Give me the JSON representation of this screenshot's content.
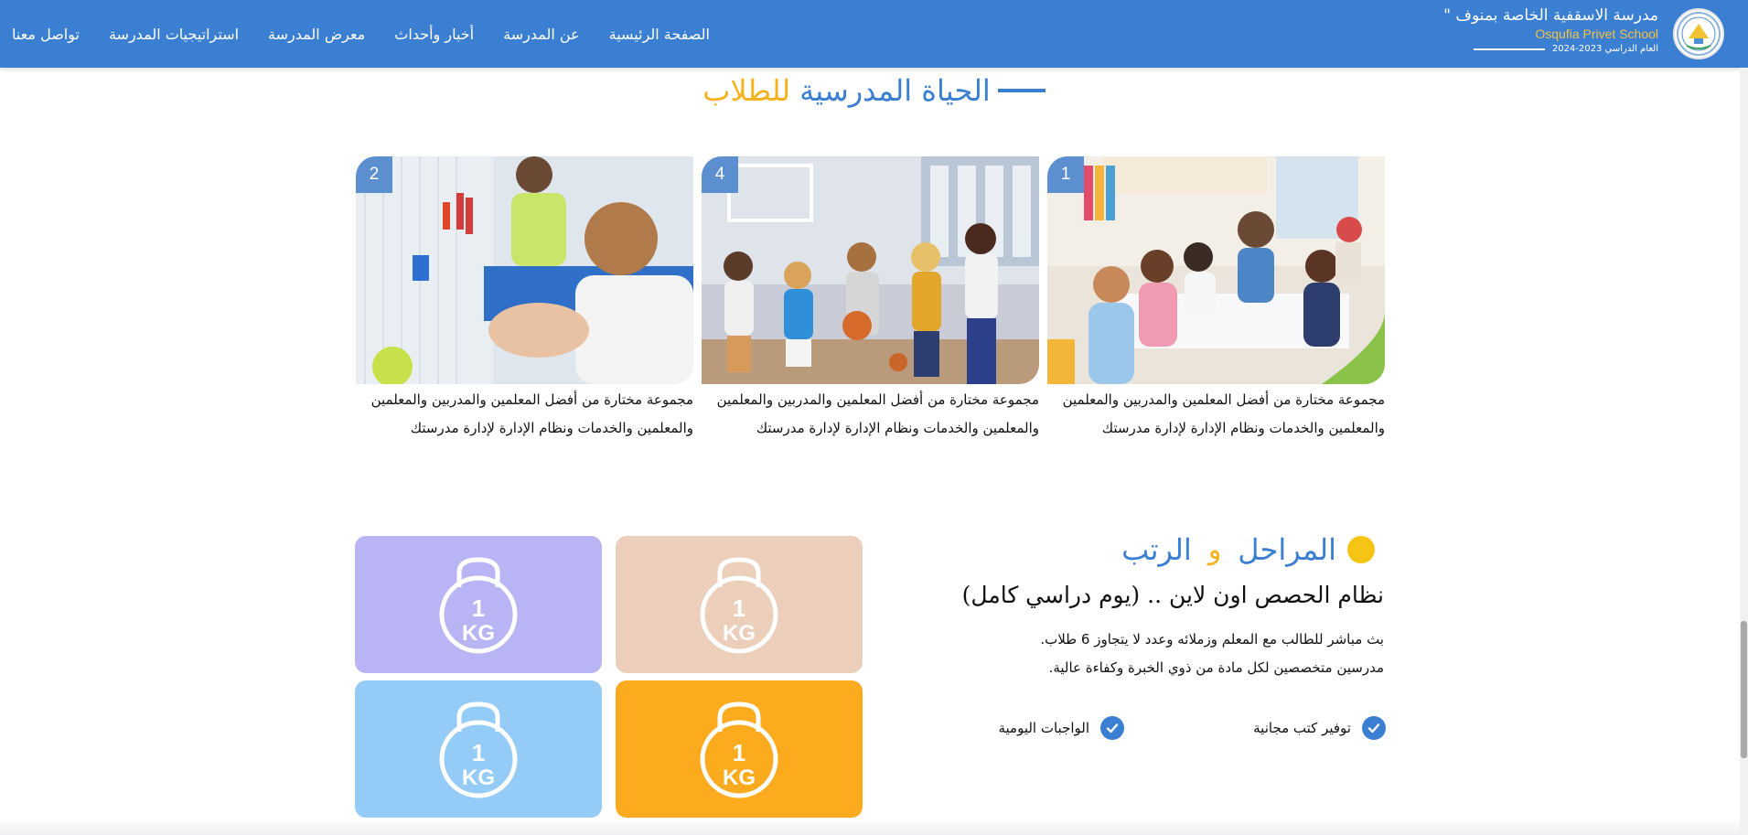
{
  "header": {
    "school_name_ar": "مدرسة الاسقفية الخاصة بمنوف \"",
    "school_name_en": "Osqufia Privet School",
    "academic_year": "العام الدراسي 2023-2024",
    "nav": [
      {
        "label": "الصفحة الرئيسية"
      },
      {
        "label": "عن المدرسة"
      },
      {
        "label": "أخبار وأحداث"
      },
      {
        "label": "معرض المدرسة"
      },
      {
        "label": "استراتيجيات المدرسة"
      },
      {
        "label": "تواصل معنا"
      }
    ]
  },
  "school_life": {
    "title_main": "الحياة المدرسية",
    "title_accent": "للطلاب",
    "cards": [
      {
        "number": "1",
        "text": "مجموعة مختارة من أفضل المعلمين والمدربين والمعلمين والمعلمين والخدمات ونظام الإدارة لإدارة مدرستك"
      },
      {
        "number": "4",
        "text": "مجموعة مختارة من أفضل المعلمين والمدربين والمعلمين والمعلمين والخدمات ونظام الإدارة لإدارة مدرستك"
      },
      {
        "number": "2",
        "text": "مجموعة مختارة من أفضل المعلمين والمدربين والمعلمين والمعلمين والخدمات ونظام الإدارة لإدارة مدرستك"
      }
    ]
  },
  "stages": {
    "title_word1": "المراحل",
    "title_and": "و",
    "title_word2": "الرتب",
    "subheading": "نظام الحصص اون لاين .. (يوم دراسي كامل)",
    "paragraphs": [
      "بث مباشر للطالب مع المعلم وزملائه وعدد لا يتجاوز 6 طلاب.",
      "مدرسين متخصصين لكل مادة من ذوي الخبرة وكفاءة عالية."
    ],
    "features": [
      {
        "label": "توفير كتب مجانية"
      },
      {
        "label": "الواجبات اليومية"
      }
    ],
    "tiles": [
      {
        "icon": "kettlebell-icon",
        "weight_top": "1",
        "weight_unit": "KG",
        "color": "#b9b5f4"
      },
      {
        "icon": "kettlebell-icon",
        "weight_top": "1",
        "weight_unit": "KG",
        "color": "#ebcfba"
      },
      {
        "icon": "kettlebell-icon",
        "weight_top": "1",
        "weight_unit": "KG",
        "color": "#94cbf7"
      },
      {
        "icon": "kettlebell-icon",
        "weight_top": "1",
        "weight_unit": "KG",
        "color": "#fcaa1e"
      }
    ]
  },
  "colors": {
    "primary": "#3b7fd2",
    "accent": "#f6b21a",
    "badge": "#5b8fd0"
  }
}
